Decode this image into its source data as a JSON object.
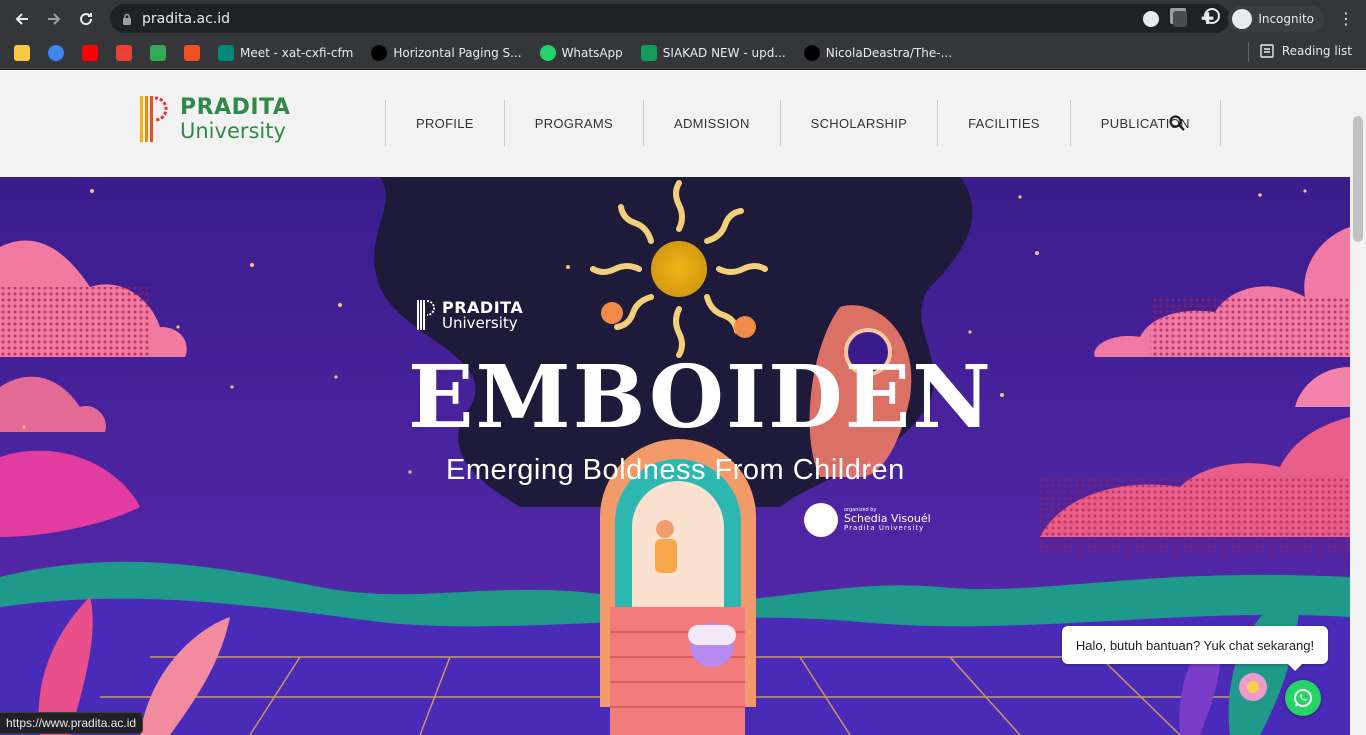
{
  "browser": {
    "url": "pradita.ac.id",
    "profile_label": "Incognito",
    "reading_list_label": "Reading list",
    "status_url": "https://www.pradita.ac.id"
  },
  "bookmarks": [
    {
      "label": "",
      "icon": "folder-icon",
      "color": "#f9c846"
    },
    {
      "label": "",
      "icon": "google-icon",
      "color": "#4285f4"
    },
    {
      "label": "",
      "icon": "youtube-icon",
      "color": "#ff0000"
    },
    {
      "label": "",
      "icon": "gmail-icon",
      "color": "#ea4335"
    },
    {
      "label": "",
      "icon": "drive-icon",
      "color": "#34a853"
    },
    {
      "label": "",
      "icon": "microsoft-icon",
      "color": "#f25022"
    },
    {
      "label": "Meet - xat-cxfi-cfm",
      "icon": "meet-icon",
      "color": "#00897b"
    },
    {
      "label": "Horizontal Paging S...",
      "icon": "github-icon",
      "color": "#000000"
    },
    {
      "label": "WhatsApp",
      "icon": "whatsapp-icon",
      "color": "#25d366"
    },
    {
      "label": "SIAKAD NEW - upd...",
      "icon": "sheets-icon",
      "color": "#0f9d58"
    },
    {
      "label": "NicolaDeastra/The-...",
      "icon": "github-icon",
      "color": "#000000"
    }
  ],
  "site": {
    "logo_line1": "PRADITA",
    "logo_line2": "University",
    "brand_green": "#2f8a4a",
    "menu": [
      "PROFILE",
      "PROGRAMS",
      "ADMISSION",
      "SCHOLARSHIP",
      "FACILITIES",
      "PUBLICATION"
    ]
  },
  "hero": {
    "logo_line1": "PRADITA",
    "logo_line2": "University",
    "title": "EMBOIDEN",
    "subtitle": "Emerging Boldness From Children",
    "org_line1": "organized by",
    "org_line2": "Schedia Visouél",
    "org_line3": "Pradita University",
    "bg_color": "#3d1d8f"
  },
  "chat": {
    "bubble_text": "Halo, butuh bantuan? Yuk chat sekarang!",
    "button_color": "#25d366"
  }
}
